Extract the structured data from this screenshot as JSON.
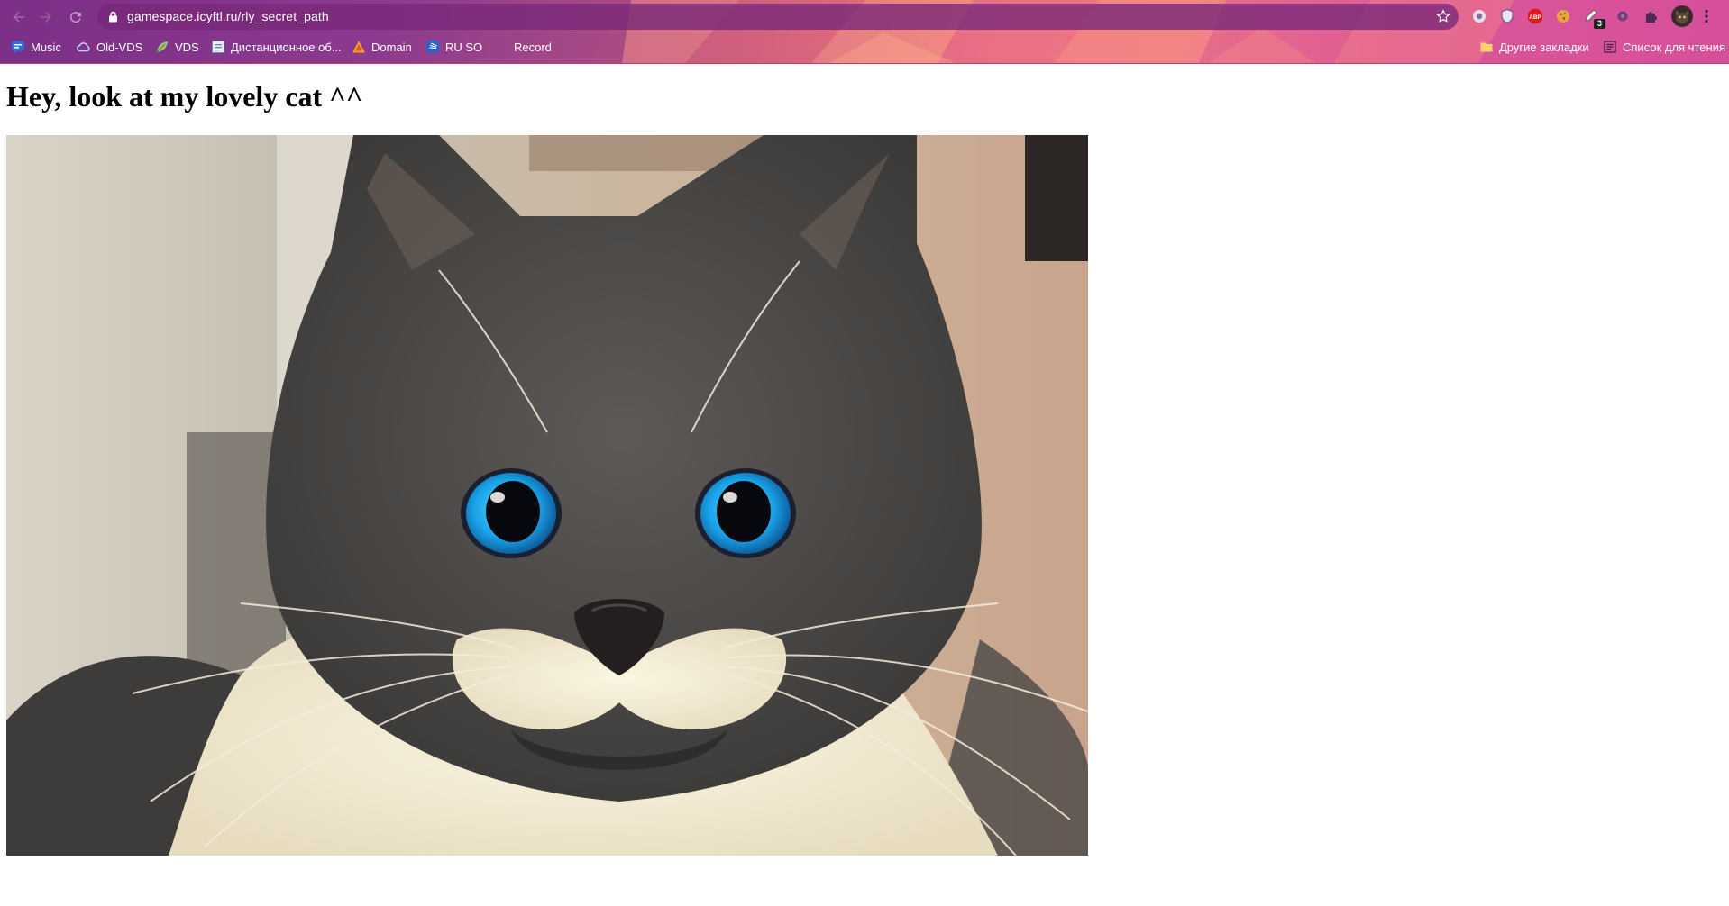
{
  "browser": {
    "url": "gamespace.icyftl.ru/rly_secret_path",
    "extension_badge_count": "3",
    "icons": [
      "back-icon",
      "forward-icon",
      "reload-icon",
      "lock-icon",
      "star-icon",
      "shield-icon",
      "abp-icon",
      "cookie-icon",
      "puzzle-icon",
      "profile-icon",
      "kebab-menu-icon"
    ],
    "bookmarks": [
      {
        "label": "Music",
        "icon": "chat-icon"
      },
      {
        "label": "Old-VDS",
        "icon": "cloud-icon"
      },
      {
        "label": "VDS",
        "icon": "leaf-icon"
      },
      {
        "label": "Дистанционное об...",
        "icon": "page-icon"
      },
      {
        "label": "Domain",
        "icon": "warning-icon"
      },
      {
        "label": "RU SO",
        "icon": "stack-icon"
      },
      {
        "label": "Record",
        "icon": "blank-icon"
      }
    ],
    "other_bookmarks_label": "Другие закладки",
    "reading_list_label": "Список для чтения",
    "colors": {
      "chrome_purple": "#7b2f86",
      "chrome_pink": "#f07a7c",
      "abp_red": "#e01a1a"
    }
  },
  "page": {
    "heading": "Hey, look at my lovely cat ^^",
    "photo": {
      "subject": "cat-photo",
      "eye_color": "#1aa3e8"
    }
  }
}
